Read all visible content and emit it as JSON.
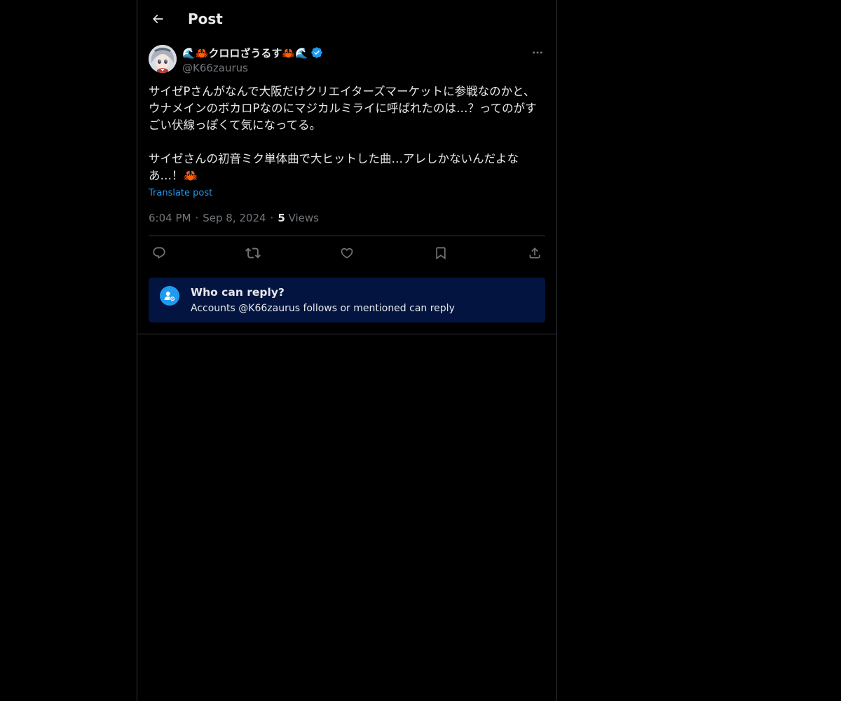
{
  "header": {
    "title": "Post",
    "back_icon": "arrow-left-icon"
  },
  "post": {
    "author": {
      "display_name": "🌊🦀クロロざうるす🦀🌊",
      "handle": "@K66zaurus",
      "verified": true
    },
    "text": "サイゼPさんがなんで大阪だけクリエイターズマーケットに参戦なのかと、ウナメインのボカロPなのにマジカルミライに呼ばれたのは…？ってのがすごい伏線っぽくて気になってる。\n\nサイゼさんの初音ミク単体曲で大ヒットした曲…アレしかないんだよなあ…！🦀",
    "translate_label": "Translate post",
    "time": "6:04 PM",
    "date": "Sep 8, 2024",
    "views_count": "5",
    "views_label": "Views",
    "actions": [
      "reply-icon",
      "repost-icon",
      "like-icon",
      "bookmark-icon",
      "share-icon"
    ]
  },
  "reply_restriction": {
    "title": "Who can reply?",
    "subtitle": "Accounts @K66zaurus follows or mentioned can reply"
  },
  "colors": {
    "background": "#000000",
    "text": "#e7e9ea",
    "muted": "#71767b",
    "accent": "#1d9bf0",
    "border": "#2f3336",
    "reply_box": "#031440"
  }
}
